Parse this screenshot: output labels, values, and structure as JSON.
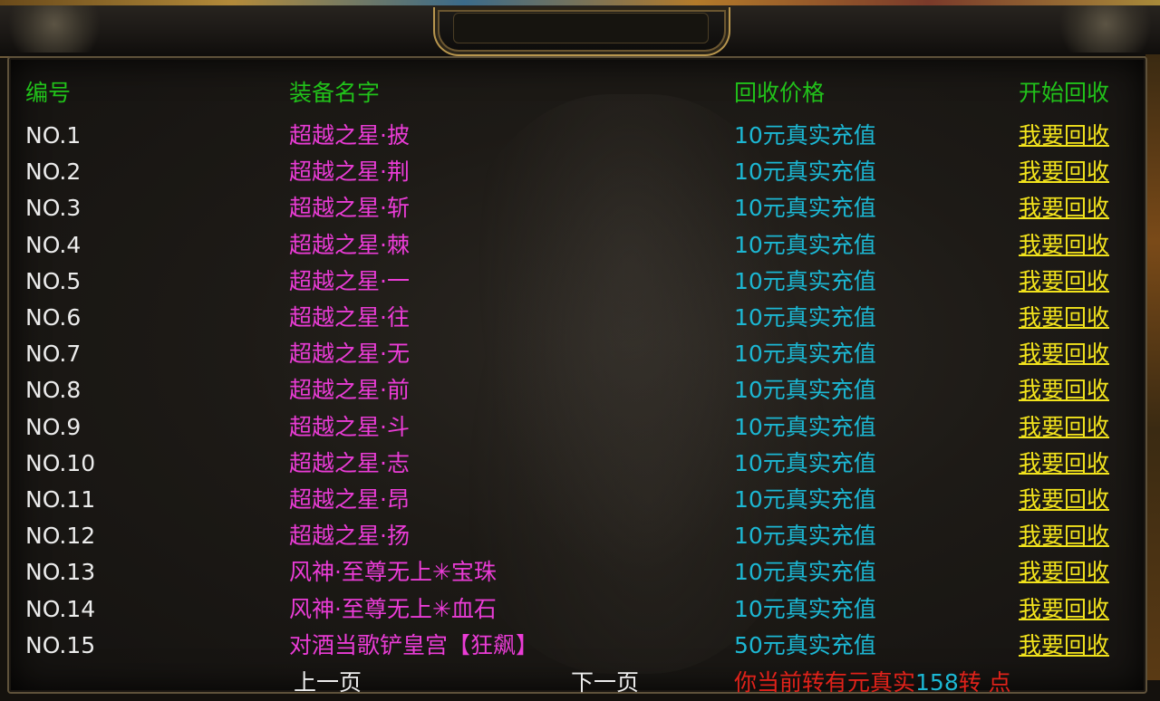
{
  "header": {
    "no": "编号",
    "name": "装备名字",
    "price": "回收价格",
    "action": "开始回收"
  },
  "rows": [
    {
      "no": "NO.1",
      "name": "超越之星·披",
      "price": "10元真实充值",
      "action": "我要回收"
    },
    {
      "no": "NO.2",
      "name": "超越之星·荆",
      "price": "10元真实充值",
      "action": "我要回收"
    },
    {
      "no": "NO.3",
      "name": "超越之星·斩",
      "price": "10元真实充值",
      "action": "我要回收"
    },
    {
      "no": "NO.4",
      "name": "超越之星·棘",
      "price": "10元真实充值",
      "action": "我要回收"
    },
    {
      "no": "NO.5",
      "name": "超越之星·一",
      "price": "10元真实充值",
      "action": "我要回收"
    },
    {
      "no": "NO.6",
      "name": "超越之星·往",
      "price": "10元真实充值",
      "action": "我要回收"
    },
    {
      "no": "NO.7",
      "name": "超越之星·无",
      "price": "10元真实充值",
      "action": "我要回收"
    },
    {
      "no": "NO.8",
      "name": "超越之星·前",
      "price": "10元真实充值",
      "action": "我要回收"
    },
    {
      "no": "NO.9",
      "name": "超越之星·斗",
      "price": "10元真实充值",
      "action": "我要回收"
    },
    {
      "no": "NO.10",
      "name": "超越之星·志",
      "price": "10元真实充值",
      "action": "我要回收"
    },
    {
      "no": "NO.11",
      "name": "超越之星·昂",
      "price": "10元真实充值",
      "action": "我要回收"
    },
    {
      "no": "NO.12",
      "name": "超越之星·扬",
      "price": "10元真实充值",
      "action": "我要回收"
    },
    {
      "no": "NO.13",
      "name": "风神·至尊无上✳宝珠",
      "price": "10元真实充值",
      "action": "我要回收"
    },
    {
      "no": "NO.14",
      "name": "风神·至尊无上✳血石",
      "price": "10元真实充值",
      "action": "我要回收"
    },
    {
      "no": "NO.15",
      "name": "对酒当歌铲皇宫【狂飙】",
      "price": "50元真实充值",
      "action": "我要回收"
    }
  ],
  "footer": {
    "prev": "上一页",
    "next": "下一页",
    "notice_prefix": "你当前转有元真实",
    "notice_count": "158",
    "notice_suffix": "转  点"
  }
}
